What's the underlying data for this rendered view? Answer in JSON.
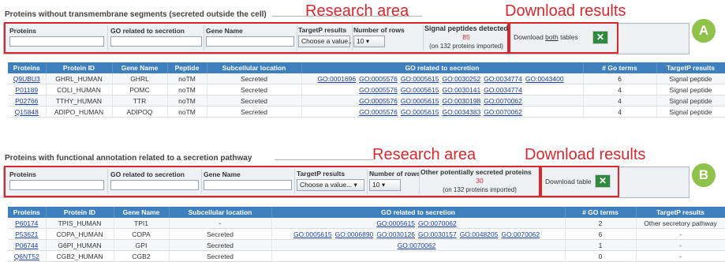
{
  "section_a": {
    "title": "Proteins without transmembrane segments (secreted outside the cell)",
    "research_annot": "Research area",
    "download_annot": "Download results",
    "badge": "A",
    "filters": {
      "proteins_label": "Proteins",
      "go_label": "GO related to secretion",
      "gene_label": "Gene Name",
      "targetp_label": "TargetP results",
      "targetp_value": "Choose a value...",
      "rows_label": "Number of rows",
      "rows_value": "10",
      "signal_label": "Signal peptides detected",
      "signal_count": "85",
      "signal_note": "(on 132 proteins imported)"
    },
    "download": {
      "prefix": "Download ",
      "both": "both",
      "suffix": " tables",
      "icon": "excel-icon"
    },
    "table": {
      "headers": [
        "Proteins",
        "Protein ID",
        "Gene Name",
        "Peptide",
        "Subcellular location",
        "GO related to secretion",
        "# Go terms",
        "TargetP results"
      ],
      "rows": [
        {
          "protein": "Q9UBU3",
          "id": "GHRL_HUMAN",
          "gene": "GHRL",
          "peptide": "noTM",
          "location": "Secreted",
          "go": [
            "GO:0001696",
            "GO:0005576",
            "GO:0005615",
            "GO:0030252",
            "GO:0034774",
            "GO:0043400"
          ],
          "terms": "6",
          "targetp": "Signal peptide"
        },
        {
          "protein": "P01189",
          "id": "COLI_HUMAN",
          "gene": "POMC",
          "peptide": "noTM",
          "location": "Secreted",
          "go": [
            "GO:0005576",
            "GO:0005615",
            "GO:0030141",
            "GO:0034774"
          ],
          "terms": "4",
          "targetp": "Signal peptide"
        },
        {
          "protein": "P02766",
          "id": "TTHY_HUMAN",
          "gene": "TTR",
          "peptide": "noTM",
          "location": "Secreted",
          "go": [
            "GO:0005576",
            "GO:0005615",
            "GO:0030198",
            "GO:0070062"
          ],
          "terms": "4",
          "targetp": "Signal peptide"
        },
        {
          "protein": "Q15848",
          "id": "ADIPO_HUMAN",
          "gene": "ADIPOQ",
          "peptide": "noTM",
          "location": "Secreted",
          "go": [
            "GO:0005576",
            "GO:0005615",
            "GO:0034383",
            "GO:0070062"
          ],
          "terms": "4",
          "targetp": "Signal peptide"
        }
      ]
    }
  },
  "section_b": {
    "title": "Proteins with functional annotation related to a secretion pathway",
    "research_annot": "Research area",
    "download_annot": "Download results",
    "badge": "B",
    "filters": {
      "proteins_label": "Proteins",
      "go_label": "GO related to secretion",
      "gene_label": "Gene Name",
      "targetp_label": "TargetP results",
      "targetp_value": "Choose a value...",
      "rows_label": "Number of rows",
      "rows_value": "10",
      "other_label": "Other potentially secreted proteins",
      "other_count": "30",
      "other_note": "(on 132 proteins imported)"
    },
    "download": {
      "label": "Download table",
      "icon": "excel-icon"
    },
    "table": {
      "headers": [
        "Proteins",
        "Protein ID",
        "Gene Name",
        "Subcellular location",
        "GO related to secretion",
        "# GO terms",
        "TargetP results"
      ],
      "rows": [
        {
          "protein": "P60174",
          "id": "TPIS_HUMAN",
          "gene": "TPI1",
          "location": "-",
          "go": [
            "GO:0005615",
            "GO:0070062"
          ],
          "terms": "2",
          "targetp": "Other secretory pathway"
        },
        {
          "protein": "P53621",
          "id": "COPA_HUMAN",
          "gene": "COPA",
          "location": "Secreted",
          "go": [
            "GO:0005615",
            "GO:0006890",
            "GO:0030126",
            "GO:0030157",
            "GO:0048205",
            "GO:0070062"
          ],
          "terms": "6",
          "targetp": "-"
        },
        {
          "protein": "P06744",
          "id": "G6PI_HUMAN",
          "gene": "GPI",
          "location": "Secreted",
          "go": [
            "GO:0070062"
          ],
          "terms": "1",
          "targetp": "-"
        },
        {
          "protein": "Q6NT52",
          "id": "CGB2_HUMAN",
          "gene": "CGB2",
          "location": "Secreted",
          "go": [],
          "terms": "0",
          "targetp": "-"
        }
      ]
    }
  },
  "colors": {
    "header_blue": "#3e7fbd",
    "annot_red": "#d9272e",
    "badge_green": "#8fc24a",
    "excel_green": "#2f8a3e"
  }
}
